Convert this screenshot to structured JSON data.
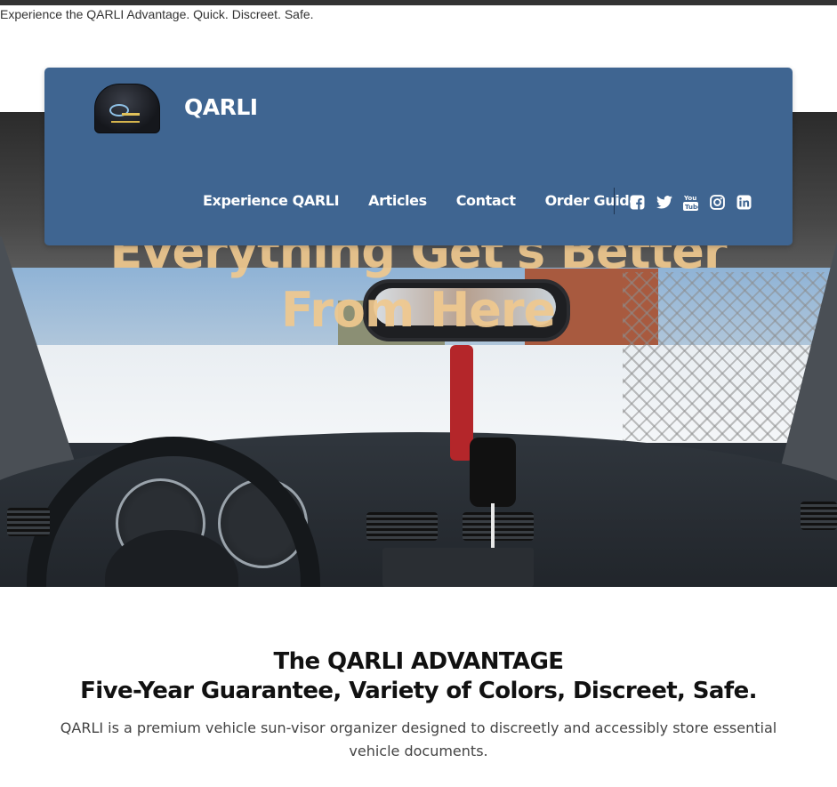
{
  "announcement": {
    "text": "Experience the QARLI Advantage. Quick. Discreet. Safe."
  },
  "header": {
    "brand": "QARLI",
    "logo_icon": "sun-visor-organizer-logo",
    "nav": [
      {
        "label": "Experience QARLI"
      },
      {
        "label": "Articles"
      },
      {
        "label": "Contact"
      },
      {
        "label": "Order Guide"
      }
    ],
    "social": [
      "facebook-icon",
      "twitter-icon",
      "youtube-icon",
      "instagram-icon",
      "linkedin-icon"
    ],
    "colors": {
      "panel": "#3f6591",
      "text": "#ffffff"
    }
  },
  "hero": {
    "title": "Everything Get's Better From Here",
    "title_color": "#f0c98f"
  },
  "advantage": {
    "title_line1": "The QARLI ADVANTAGE",
    "title_line2": "Five-Year Guarantee, Variety of Colors, Discreet, Safe.",
    "description": "QARLI is a premium vehicle sun-visor organizer designed to discreetly and accessibly store essential vehicle documents."
  }
}
